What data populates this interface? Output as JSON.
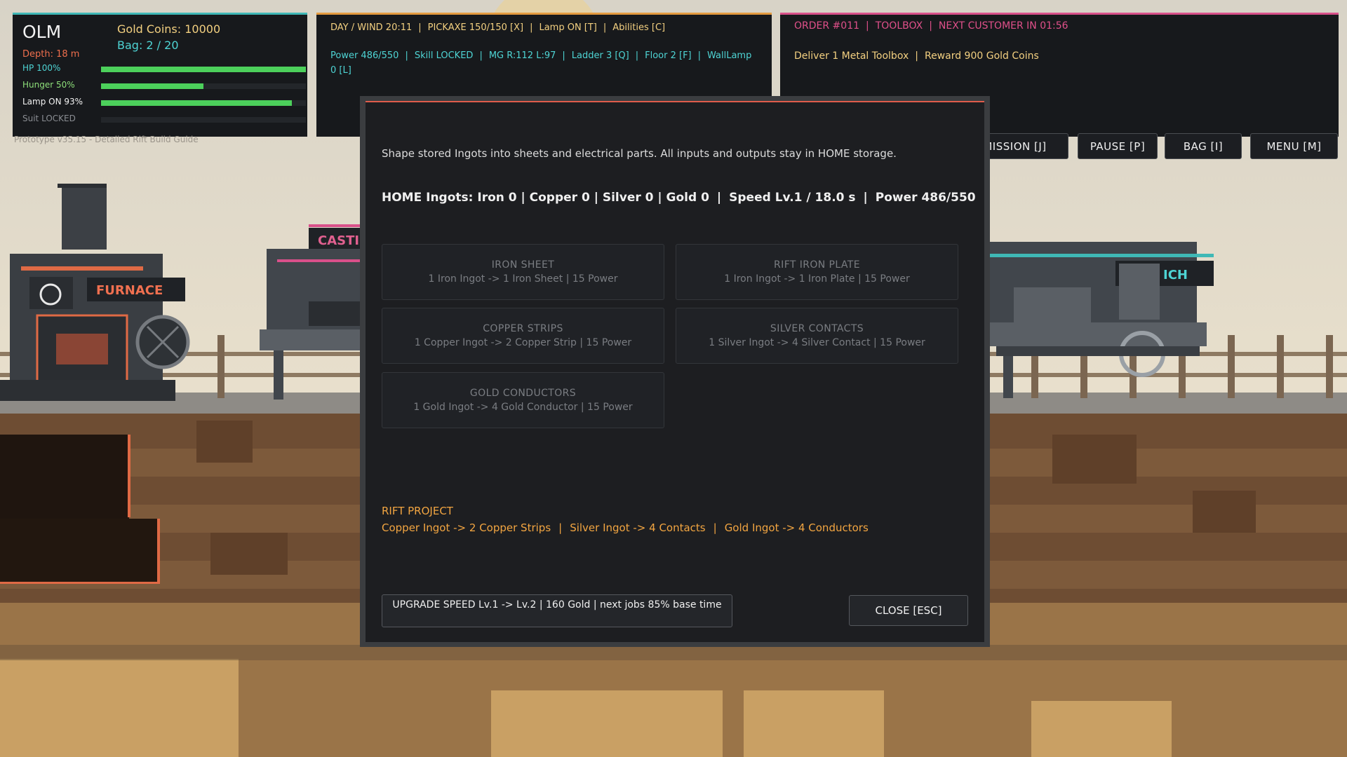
{
  "player": {
    "name": "OLM",
    "gold": "Gold Coins: 10000",
    "bag": "Bag: 2 / 20",
    "depth": "Depth: 18 m",
    "stats": [
      {
        "label": "HP 100%",
        "level": 1.0,
        "color": "#4cd05b",
        "label_color": "#4ed4d4"
      },
      {
        "label": "Hunger 50%",
        "level": 0.5,
        "color": "#4cd05b",
        "label_color": "#8ee07a"
      },
      {
        "label": "Lamp ON 93%",
        "level": 0.93,
        "color": "#4cd05b",
        "label_color": "#f2f2f2"
      },
      {
        "label": "Suit LOCKED",
        "level": 0.0,
        "color": "#4cd05b",
        "label_color": "#8a8d92"
      }
    ],
    "version": "Prototype v35.15 - Detailed Rift Build Guide"
  },
  "status": {
    "line1": [
      "DAY / WIND 20:11",
      "PICKAXE 150/150 [X]",
      "Lamp ON [T]",
      "Abilities [C]"
    ],
    "line2": [
      "Power 486/550",
      "Skill LOCKED",
      "MG R:112 L:97",
      "Ladder 3 [Q]",
      "Floor 2 [F]",
      "WallLamp"
    ],
    "line3": "0 [L]"
  },
  "order": {
    "line1": [
      "ORDER #011",
      "TOOLBOX",
      "NEXT CUSTOMER IN 01:56"
    ],
    "line2": [
      "Deliver 1 Metal Toolbox",
      "Reward 900 Gold Coins"
    ]
  },
  "top_buttons": {
    "mission": "MISSION [J]",
    "pause": "PAUSE [P]",
    "bag": "BAG [I]",
    "menu": "MENU [M]"
  },
  "scene": {
    "furnace_sign": "FURNACE",
    "casting_sign": "CASTI",
    "workbench_sign": "ICH"
  },
  "modal": {
    "description": "Shape stored Ingots into sheets and electrical parts. All inputs and outputs stay in HOME storage.",
    "ingots": [
      "HOME Ingots: Iron 0 | Copper 0 | Silver 0 | Gold 0",
      "Speed Lv.1 / 18.0 s",
      "Power 486/550"
    ],
    "recipes": [
      {
        "title": "IRON SHEET",
        "detail": "1 Iron Ingot -> 1 Iron Sheet   |   15 Power"
      },
      {
        "title": "RIFT IRON PLATE",
        "detail": "1 Iron Ingot -> 1 Iron Plate   |   15 Power"
      },
      {
        "title": "COPPER STRIPS",
        "detail": "1 Copper Ingot -> 2 Copper Strip   |   15 Power"
      },
      {
        "title": "SILVER CONTACTS",
        "detail": "1 Silver Ingot -> 4 Silver Contact   |   15 Power"
      },
      {
        "title": "GOLD CONDUCTORS",
        "detail": "1 Gold Ingot -> 4 Gold Conductor   |   15 Power"
      }
    ],
    "rift_title": "RIFT PROJECT",
    "rift_items": [
      "Copper Ingot -> 2 Copper Strips",
      "Silver Ingot -> 4 Contacts",
      "Gold Ingot -> 4 Conductors"
    ],
    "upgrade_label": "UPGRADE SPEED   Lv.1 -> Lv.2   |   160 Gold   |   next jobs 85% base time",
    "close_label": "CLOSE [ESC]"
  },
  "colors": {
    "accent_teal": "#3fb8b6",
    "accent_orange": "#e39a3f",
    "accent_pink": "#d9508a",
    "rift_orange": "#f2a541",
    "bar_green": "#4cd05b"
  }
}
